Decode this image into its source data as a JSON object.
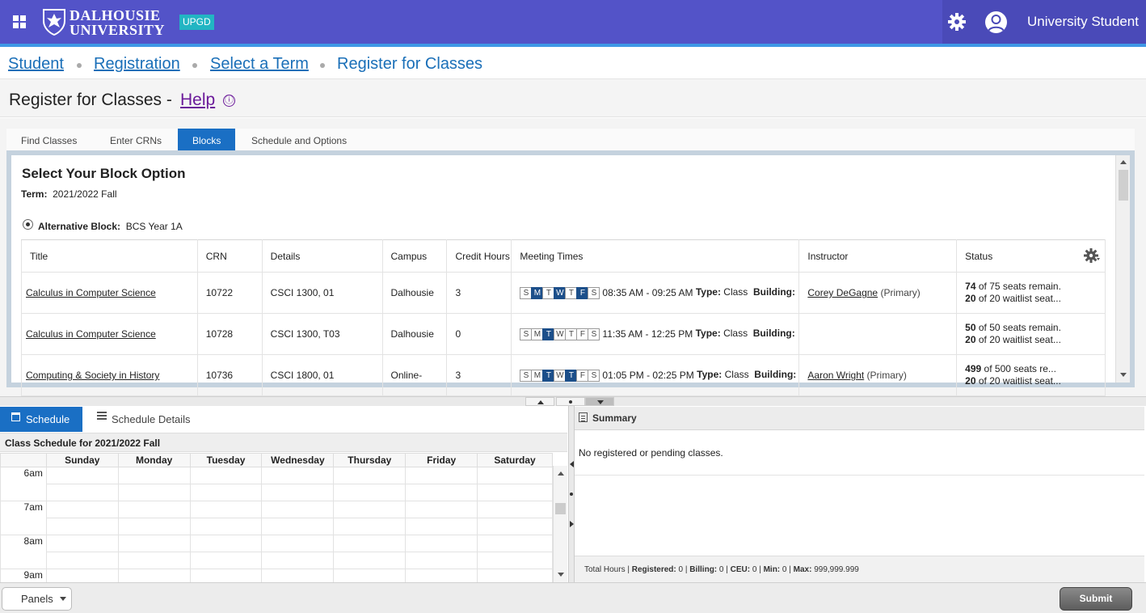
{
  "header": {
    "logo_line1": "DALHOUSIE",
    "logo_line2": "UNIVERSITY",
    "badge": "UPGD",
    "user_name": "University Student",
    "accent": "#5353c8",
    "icons": [
      "apps-grid-icon",
      "shield-logo-icon",
      "gear-icon",
      "user-avatar-icon"
    ]
  },
  "breadcrumb": {
    "items": [
      "Student",
      "Registration",
      "Select a Term",
      "Register for Classes"
    ]
  },
  "page": {
    "title": "Register for Classes - ",
    "help": "Help",
    "help_icon": "ⓘ"
  },
  "tabs": [
    "Find Classes",
    "Enter CRNs",
    "Blocks",
    "Schedule and Options"
  ],
  "block": {
    "heading": "Select Your Block Option",
    "term_label": "Term:",
    "term_value": "2021/2022 Fall",
    "alt_label": "Alternative Block:",
    "alt_value": "BCS Year 1A"
  },
  "table": {
    "columns": [
      "Title",
      "CRN",
      "Details",
      "Campus",
      "Credit Hours",
      "Meeting Times",
      "Instructor",
      "Status"
    ],
    "rows": [
      {
        "title": "Calculus in Computer Science",
        "crn": "10722",
        "details": "CSCI 1300, 01",
        "campus": "Dalhousie",
        "credit": "3",
        "days": [
          "S",
          "M",
          "T",
          "W",
          "T",
          "F",
          "S"
        ],
        "active_days": [
          false,
          true,
          false,
          true,
          false,
          true,
          false
        ],
        "time": "08:35 AM - 09:25 AM",
        "type_label": "Type:",
        "type_value": "Class",
        "building_label": "Building:",
        "instructor": "Corey DeGagne",
        "instructor_role": "(Primary)",
        "seats_bold": "74",
        "seats_text": "of 75 seats remain.",
        "wait_bold": "20",
        "wait_text": "of 20 waitlist seat..."
      },
      {
        "title": "Calculus in Computer Science",
        "crn": "10728",
        "details": "CSCI 1300, T03",
        "campus": "Dalhousie",
        "credit": "0",
        "days": [
          "S",
          "M",
          "T",
          "W",
          "T",
          "F",
          "S"
        ],
        "active_days": [
          false,
          false,
          true,
          false,
          false,
          false,
          false
        ],
        "time": "11:35 AM - 12:25 PM",
        "type_label": "Type:",
        "type_value": "Class",
        "building_label": "Building:",
        "instructor": "",
        "instructor_role": "",
        "seats_bold": "50",
        "seats_text": "of 50 seats remain.",
        "wait_bold": "20",
        "wait_text": "of 20 waitlist seat..."
      },
      {
        "title": "Computing & Society in History",
        "crn": "10736",
        "details": "CSCI 1800, 01",
        "campus": "Online-",
        "credit": "3",
        "days": [
          "S",
          "M",
          "T",
          "W",
          "T",
          "F",
          "S"
        ],
        "active_days": [
          false,
          false,
          true,
          false,
          true,
          false,
          false
        ],
        "time": "01:05 PM - 02:25 PM",
        "type_label": "Type:",
        "type_value": "Class",
        "building_label": "Building:",
        "instructor": "Aaron Wright",
        "instructor_role": "(Primary)",
        "seats_bold": "499",
        "seats_text": "of 500 seats re...",
        "wait_bold": "20",
        "wait_text": "of 20 waitlist seat..."
      }
    ]
  },
  "schedule": {
    "tab_active": "Schedule",
    "tab_other": "Schedule Details",
    "header": "Class Schedule for 2021/2022 Fall",
    "days": [
      "Sunday",
      "Monday",
      "Tuesday",
      "Wednesday",
      "Thursday",
      "Friday",
      "Saturday"
    ],
    "times": [
      "6am",
      "7am",
      "8am",
      "9am"
    ]
  },
  "summary": {
    "title": "Summary",
    "empty": "No registered or pending classes.",
    "totals": {
      "label": "Total Hours",
      "registered_label": "Registered:",
      "registered": "0",
      "billing_label": "Billing:",
      "billing": "0",
      "ceu_label": "CEU:",
      "ceu": "0",
      "min_label": "Min:",
      "min": "0",
      "max_label": "Max:",
      "max": "999,999.999"
    }
  },
  "footer": {
    "panels": "Panels",
    "submit": "Submit"
  }
}
